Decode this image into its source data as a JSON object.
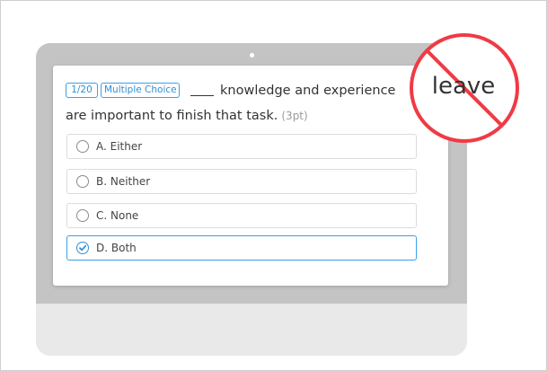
{
  "question": {
    "count_badge": "1/20",
    "type_badge": "Multiple Choice",
    "text_line1": "knowledge and experience",
    "text_line2": "are important to finish that task.",
    "points": "(3pt)"
  },
  "options": [
    {
      "label": "A. Either",
      "selected": false
    },
    {
      "label": "B. Neither",
      "selected": false
    },
    {
      "label": "C. None",
      "selected": false
    },
    {
      "label": "D. Both",
      "selected": true
    }
  ],
  "stamp": {
    "word": "leave",
    "color": "#f03a45"
  },
  "colors": {
    "accent": "#3a9fe8",
    "monitor_screen": "#c4c4c4",
    "monitor_body": "#e6e6e6"
  }
}
